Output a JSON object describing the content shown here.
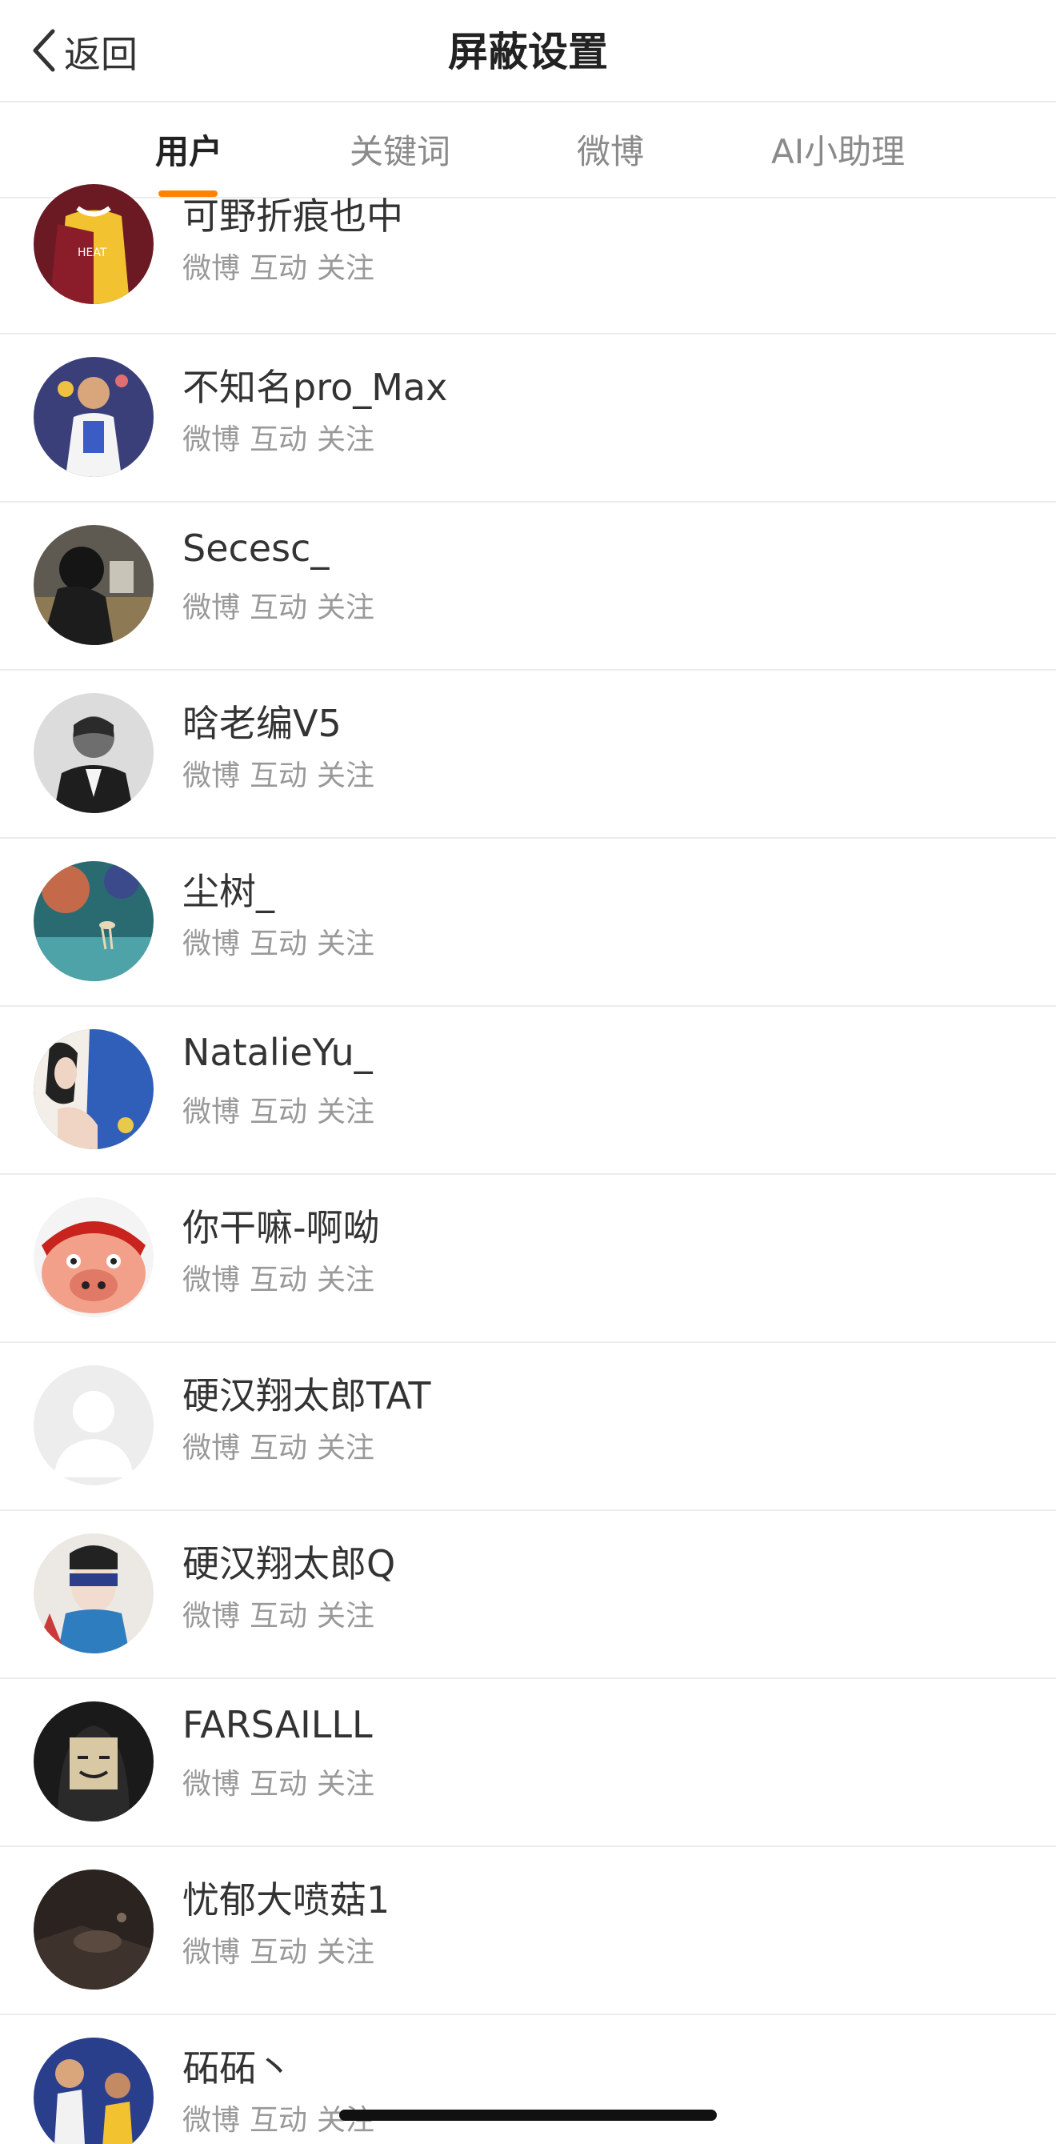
{
  "header": {
    "back_label": "返回",
    "title": "屏蔽设置"
  },
  "tabs": [
    {
      "label": "用户",
      "active": true
    },
    {
      "label": "关键词",
      "active": false
    },
    {
      "label": "微博",
      "active": false
    },
    {
      "label": "AI小助理",
      "active": false
    }
  ],
  "accent_color": "#ff8200",
  "users": [
    {
      "name": "可野折痕也中",
      "actions": [
        "微博",
        "互动",
        "关注"
      ]
    },
    {
      "name": "不知名pro_Max",
      "actions": [
        "微博",
        "互动",
        "关注"
      ]
    },
    {
      "name": "Secesc_",
      "actions": [
        "微博",
        "互动",
        "关注"
      ]
    },
    {
      "name": "晗老编V5",
      "actions": [
        "微博",
        "互动",
        "关注"
      ]
    },
    {
      "name": "尘树_",
      "actions": [
        "微博",
        "互动",
        "关注"
      ]
    },
    {
      "name": "NatalieYu_",
      "actions": [
        "微博",
        "互动",
        "关注"
      ]
    },
    {
      "name": "你干嘛-啊呦",
      "actions": [
        "微博",
        "互动",
        "关注"
      ]
    },
    {
      "name": "硬汉翔太郎TAT",
      "actions": [
        "微博",
        "互动",
        "关注"
      ]
    },
    {
      "name": "硬汉翔太郎Q",
      "actions": [
        "微博",
        "互动",
        "关注"
      ]
    },
    {
      "name": "FARSAILLL",
      "actions": [
        "微博",
        "互动",
        "关注"
      ]
    },
    {
      "name": "忧郁大喷菇1",
      "actions": [
        "微博",
        "互动",
        "关注"
      ]
    },
    {
      "name": "砳砳丶",
      "actions": [
        "微博",
        "互动",
        "关注"
      ]
    }
  ]
}
